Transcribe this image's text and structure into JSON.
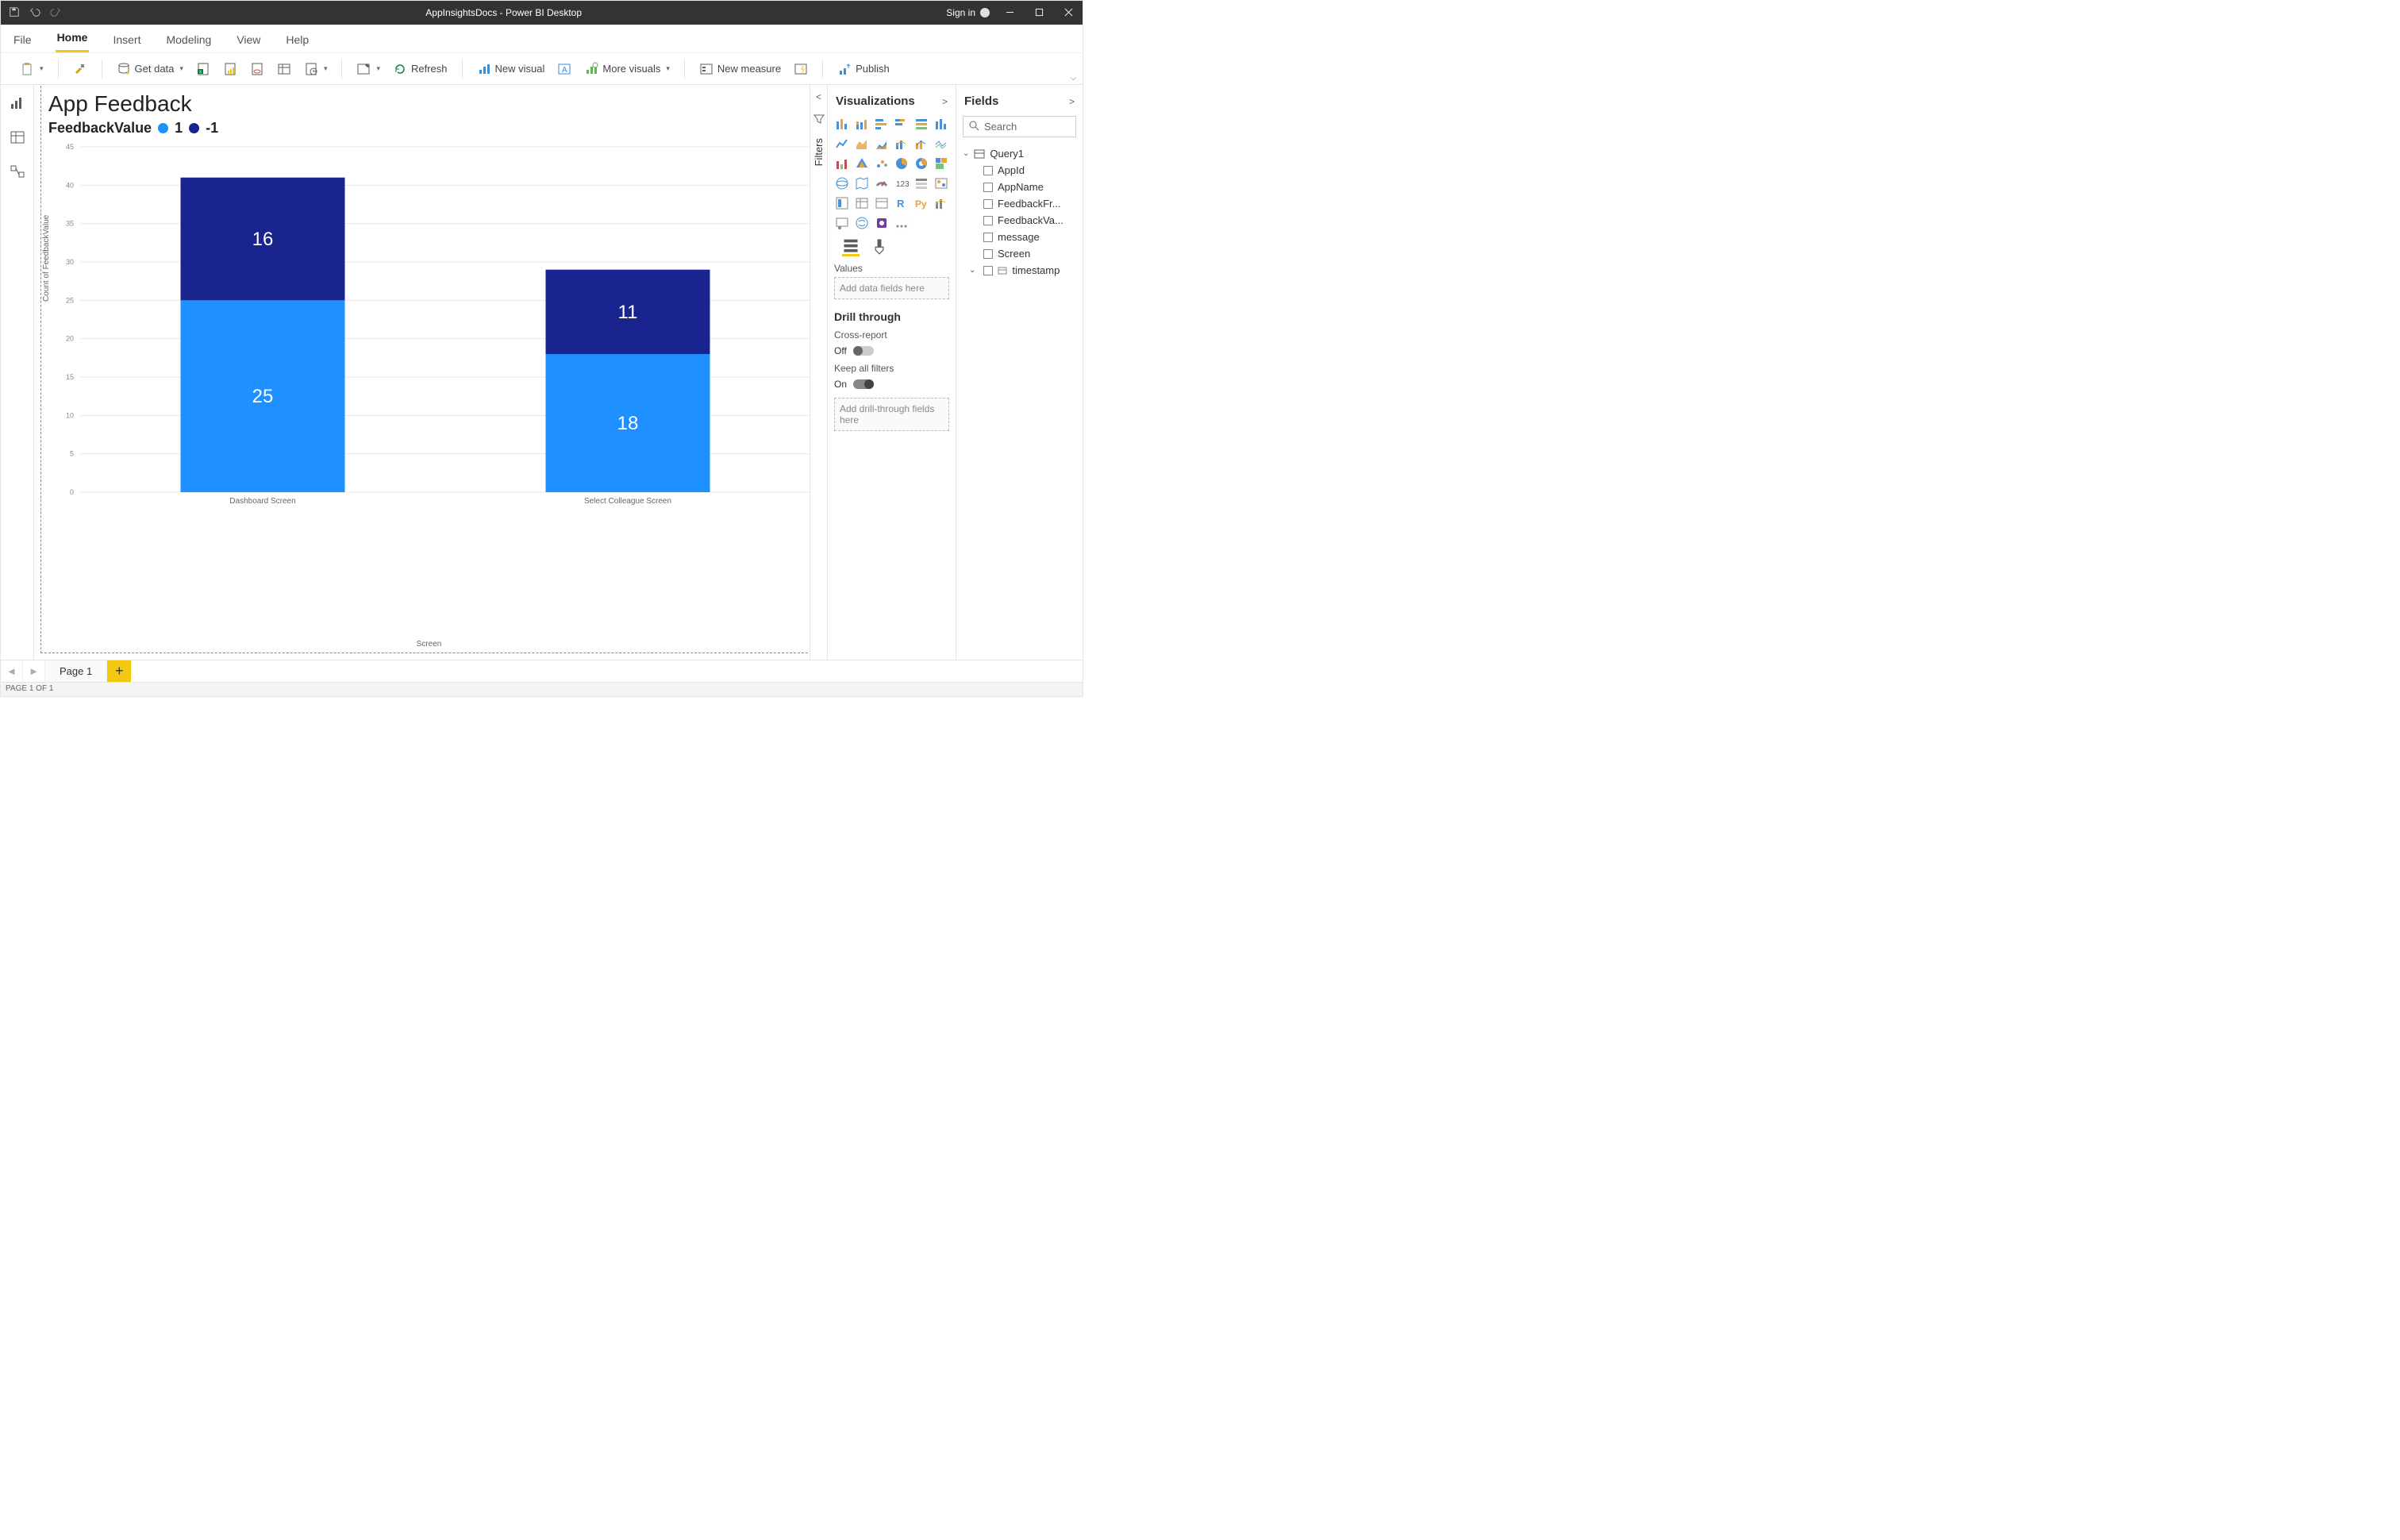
{
  "titlebar": {
    "title": "AppInsightsDocs - Power BI Desktop",
    "signin_label": "Sign in"
  },
  "menu": {
    "tabs": [
      "File",
      "Home",
      "Insert",
      "Modeling",
      "View",
      "Help"
    ],
    "active": "Home"
  },
  "ribbon": {
    "get_data": "Get data",
    "refresh": "Refresh",
    "new_visual": "New visual",
    "more_visuals": "More visuals",
    "new_measure": "New measure",
    "publish": "Publish"
  },
  "report": {
    "title": "App Feedback",
    "legend_field": "FeedbackValue",
    "legend_items": [
      {
        "label": "1",
        "color": "#1E90FF"
      },
      {
        "label": "-1",
        "color": "#19248F"
      }
    ],
    "y_axis_title": "Count of FeedbackValue",
    "x_axis_title": "Screen"
  },
  "chart_data": {
    "type": "bar",
    "stacked": true,
    "categories": [
      "Dashboard Screen",
      "Select Colleague Screen"
    ],
    "series": [
      {
        "name": "1",
        "color": "#1E90FF",
        "values": [
          25,
          18
        ]
      },
      {
        "name": "-1",
        "color": "#19248F",
        "values": [
          16,
          11
        ]
      }
    ],
    "title": "App Feedback",
    "xlabel": "Screen",
    "ylabel": "Count of FeedbackValue",
    "ylim": [
      0,
      45
    ],
    "yticks": [
      0,
      5,
      10,
      15,
      20,
      25,
      30,
      35,
      40,
      45
    ]
  },
  "filters": {
    "label": "Filters"
  },
  "vis_pane": {
    "title": "Visualizations",
    "values_label": "Values",
    "values_placeholder": "Add data fields here",
    "drill_title": "Drill through",
    "cross_label": "Cross-report",
    "cross_state": "Off",
    "keep_label": "Keep all filters",
    "keep_state": "On",
    "drill_placeholder": "Add drill-through fields here"
  },
  "fields_pane": {
    "title": "Fields",
    "search_placeholder": "Search",
    "table": "Query1",
    "columns": [
      "AppId",
      "AppName",
      "FeedbackFr...",
      "FeedbackVa...",
      "message",
      "Screen",
      "timestamp"
    ]
  },
  "page_tabs": {
    "pages": [
      "Page 1"
    ]
  },
  "status": "PAGE 1 OF 1"
}
